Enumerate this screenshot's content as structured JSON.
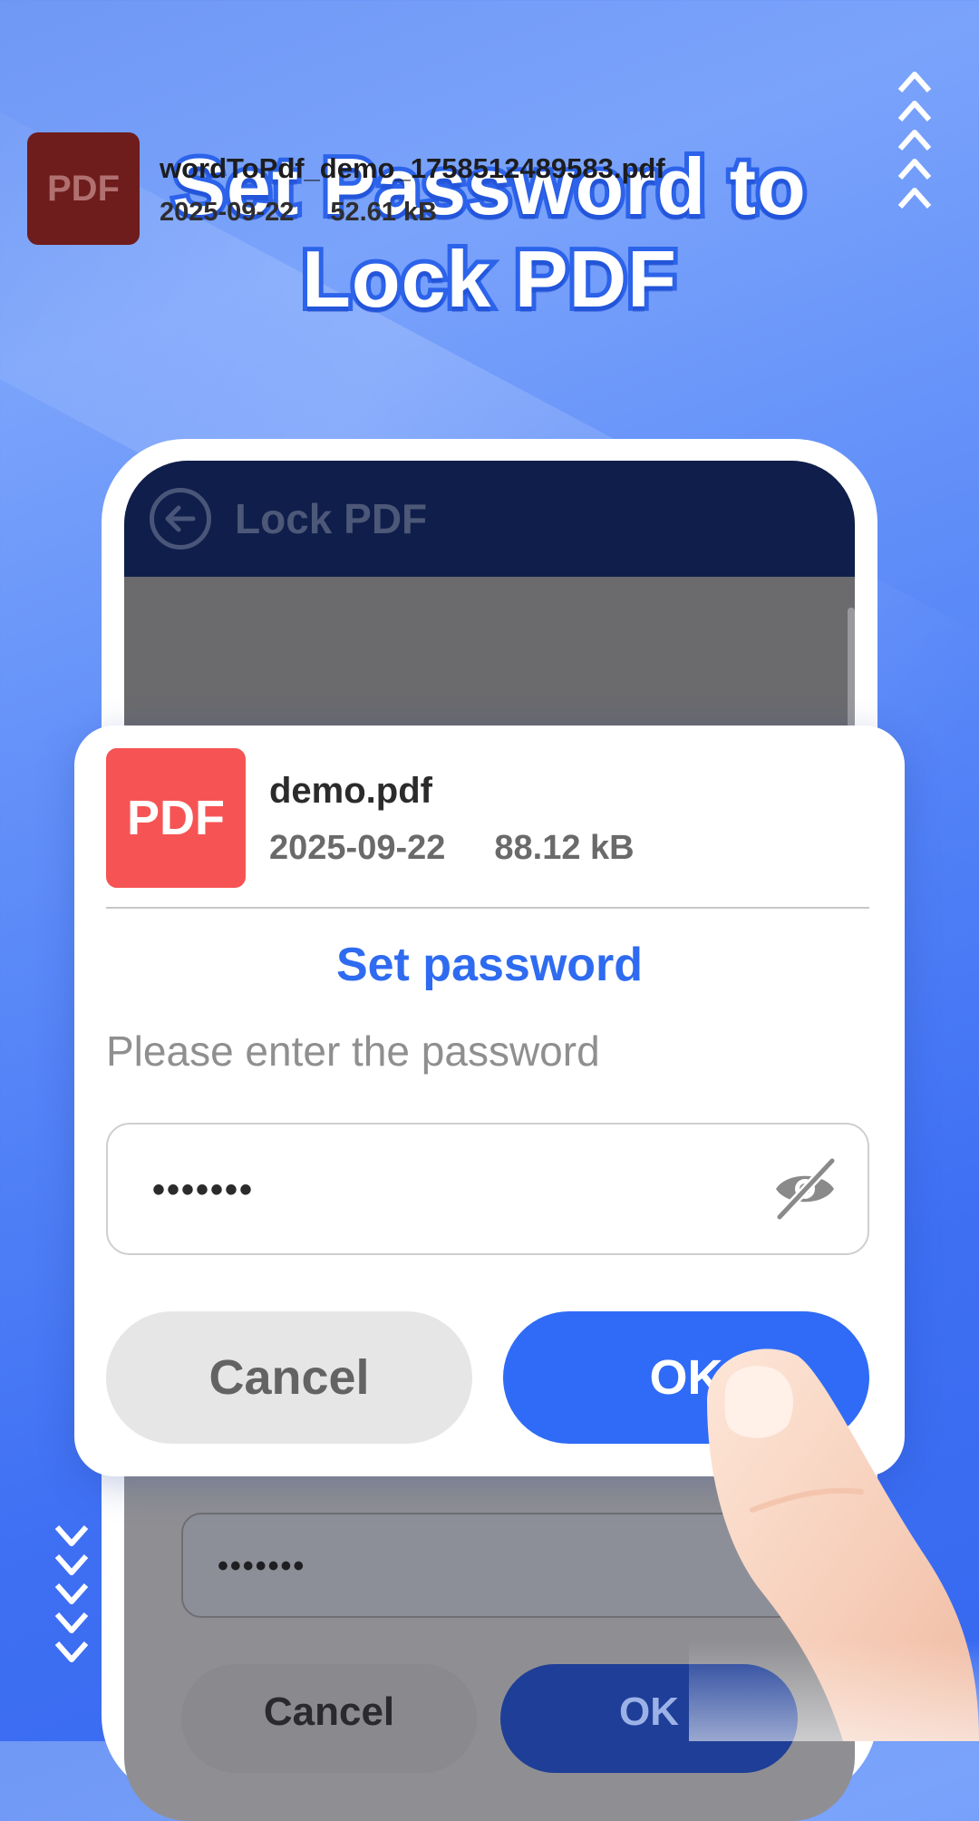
{
  "promo": {
    "headline_line1": "Set Password to",
    "headline_line2": "Lock PDF"
  },
  "background_app": {
    "header_title": "Lock PDF",
    "back_icon": "arrow-left-circle-icon",
    "file": {
      "badge": "PDF",
      "name": "wordToPdf_demo_1758512489583.pdf",
      "date": "2025-09-22",
      "size": "52.61 kB"
    },
    "password_value": "•••••••",
    "cancel_label": "Cancel",
    "ok_label": "OK"
  },
  "dialog": {
    "file": {
      "badge": "PDF",
      "name": "demo.pdf",
      "date": "2025-09-22",
      "size": "88.12 kB"
    },
    "title": "Set password",
    "hint": "Please enter the password",
    "password_value": "•••••••",
    "visibility_icon": "eye-slash-icon",
    "cancel_label": "Cancel",
    "ok_label": "OK"
  },
  "colors": {
    "accent": "#2f6bf6",
    "pdf_badge": "#f65454",
    "header_navy": "#0f1e4a"
  }
}
